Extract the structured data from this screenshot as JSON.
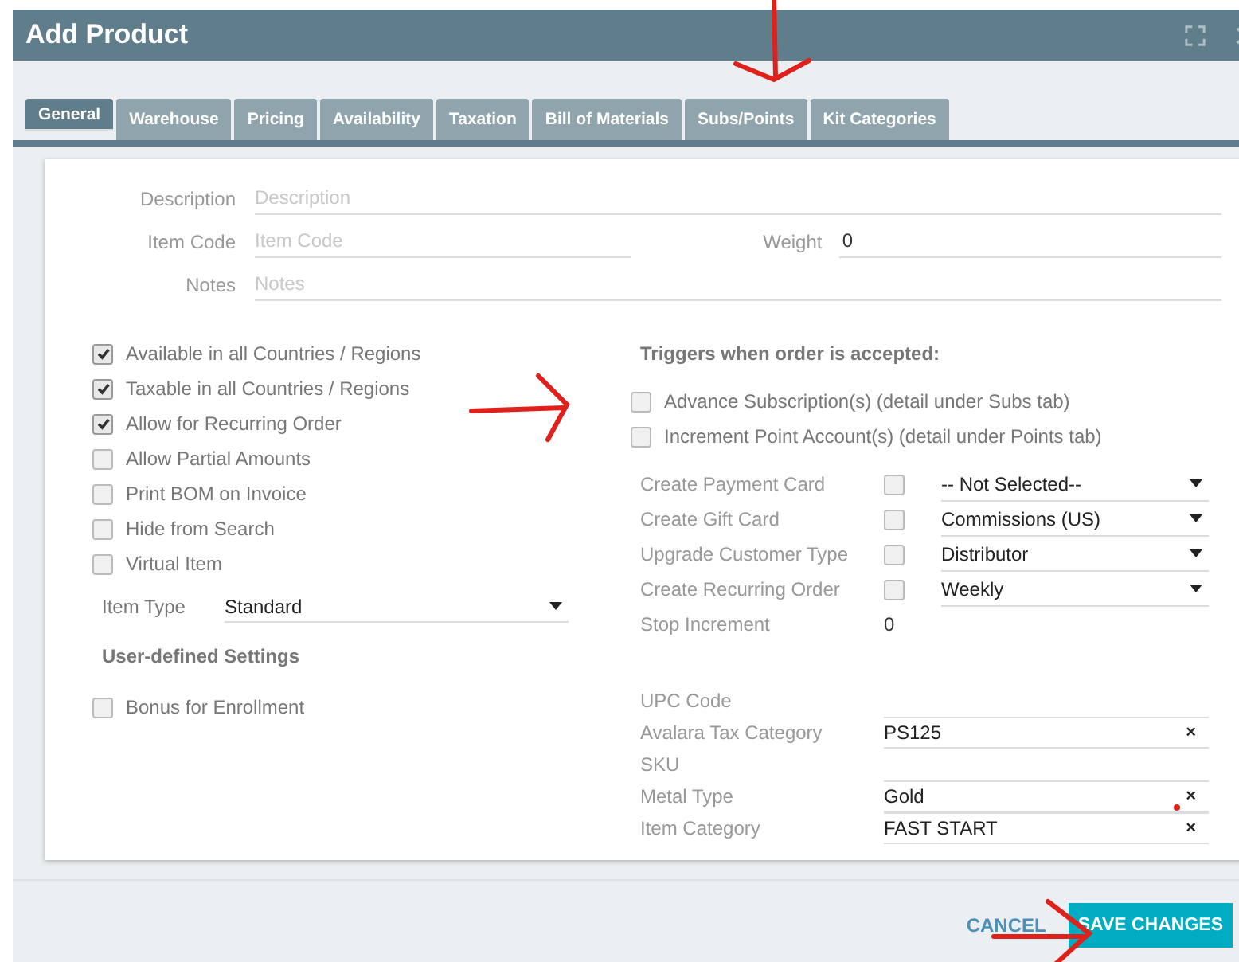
{
  "window": {
    "title": "Add Product"
  },
  "tabs": [
    {
      "label": "General",
      "selected": true
    },
    {
      "label": "Warehouse",
      "selected": false
    },
    {
      "label": "Pricing",
      "selected": false
    },
    {
      "label": "Availability",
      "selected": false
    },
    {
      "label": "Taxation",
      "selected": false
    },
    {
      "label": "Bill of Materials",
      "selected": false
    },
    {
      "label": "Subs/Points",
      "selected": false
    },
    {
      "label": "Kit Categories",
      "selected": false
    }
  ],
  "description": {
    "label": "Description",
    "placeholder": "Description"
  },
  "item_code": {
    "label": "Item Code",
    "placeholder": "Item Code"
  },
  "weight": {
    "label": "Weight",
    "value": "0"
  },
  "notes": {
    "label": "Notes",
    "placeholder": "Notes"
  },
  "options": [
    {
      "label": "Available in all Countries / Regions",
      "checked": true
    },
    {
      "label": "Taxable in all Countries / Regions",
      "checked": true
    },
    {
      "label": "Allow for Recurring Order",
      "checked": true
    },
    {
      "label": "Allow Partial Amounts",
      "checked": false
    },
    {
      "label": "Print BOM on Invoice",
      "checked": false
    },
    {
      "label": "Hide from Search",
      "checked": false
    },
    {
      "label": "Virtual Item",
      "checked": false
    }
  ],
  "item_type": {
    "label": "Item Type",
    "value": "Standard"
  },
  "user_defined": {
    "heading": "User-defined Settings",
    "options": [
      {
        "label": "Bonus for Enrollment",
        "checked": false
      }
    ]
  },
  "triggers": {
    "heading": "Triggers when order is accepted:",
    "options": [
      {
        "label": "Advance Subscription(s) (detail under Subs tab)",
        "checked": false
      },
      {
        "label": "Increment Point Account(s) (detail under Points tab)",
        "checked": false
      }
    ],
    "actions": [
      {
        "label": "Create Payment Card",
        "checked": false,
        "value": "-- Not Selected--"
      },
      {
        "label": "Create Gift Card",
        "checked": false,
        "value": "Commissions (US)"
      },
      {
        "label": "Upgrade Customer Type",
        "checked": false,
        "value": "Distributor"
      },
      {
        "label": "Create Recurring Order",
        "checked": false,
        "value": "Weekly"
      }
    ],
    "stop_increment": {
      "label": "Stop Increment",
      "value": "0"
    }
  },
  "attributes": [
    {
      "label": "UPC Code"
    },
    {
      "label": "Avalara Tax Category",
      "value": "PS125",
      "clear": "×"
    },
    {
      "label": "SKU"
    },
    {
      "label": "Metal Type",
      "value": "Gold",
      "clear": "×"
    },
    {
      "label": "Item Category",
      "value": "FAST START",
      "clear": "×"
    }
  ],
  "footer": {
    "cancel": "CANCEL",
    "save": "SAVE CHANGES"
  }
}
